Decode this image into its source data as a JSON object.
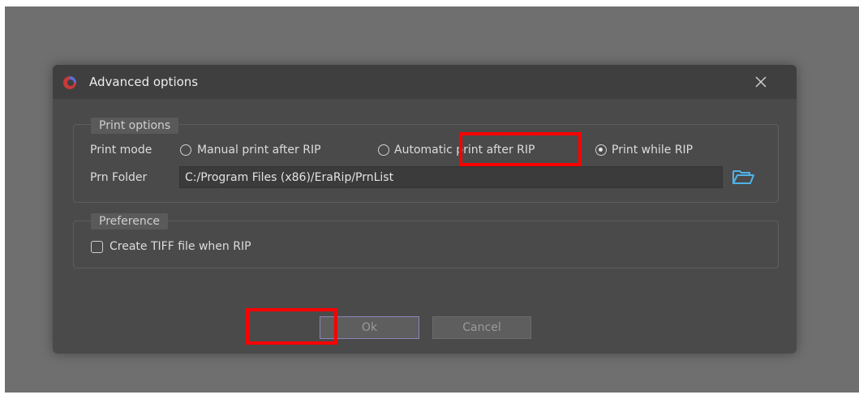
{
  "dialog": {
    "title": "Advanced options",
    "app_icon": "erarip-logo-icon",
    "close_icon": "close-icon"
  },
  "print_options": {
    "legend": "Print options",
    "print_mode_label": "Print mode",
    "modes": [
      {
        "label": "Manual print after RIP",
        "selected": false
      },
      {
        "label": "Automatic print after RIP",
        "selected": false
      },
      {
        "label": "Print while RIP",
        "selected": true
      }
    ],
    "prn_folder_label": "Prn Folder",
    "prn_folder_value": "C:/Program Files (x86)/EraRip/PrnList",
    "folder_icon": "folder-open-icon"
  },
  "preference": {
    "legend": "Preference",
    "create_tiff_label": "Create TIFF file when RIP",
    "create_tiff_checked": false
  },
  "buttons": {
    "ok_label": "Ok",
    "cancel_label": "Cancel"
  },
  "colors": {
    "highlight": "#ff0000",
    "dialog_bg": "#4a4a4a",
    "titlebar_bg": "#3f3f3f",
    "ok_border": "#8b86b8"
  }
}
